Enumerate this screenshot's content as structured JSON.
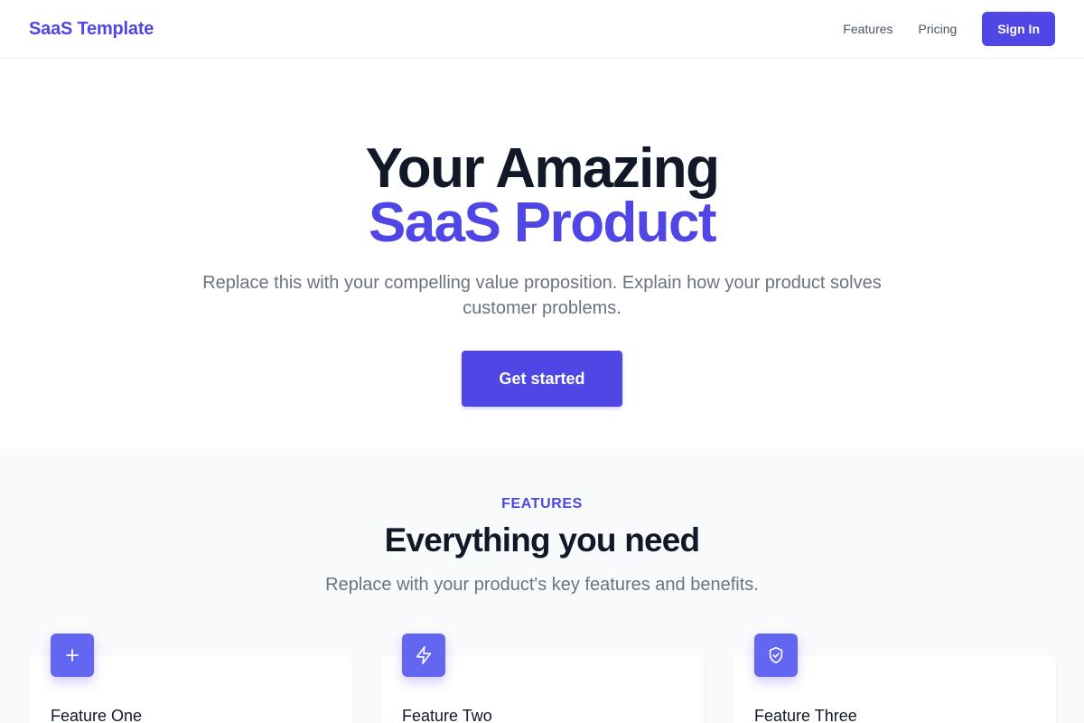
{
  "navbar": {
    "brand": "SaaS Template",
    "links": [
      "Features",
      "Pricing"
    ],
    "signin_label": "Sign In"
  },
  "hero": {
    "title_line_1": "Your Amazing",
    "title_line_2": "SaaS Product",
    "subtitle": "Replace this with your compelling value proposition. Explain how your product solves customer problems.",
    "cta_label": "Get started"
  },
  "features": {
    "eyebrow": "FEATURES",
    "title": "Everything you need",
    "subtitle": "Replace with your product's key features and benefits.",
    "cards": [
      {
        "name": "Feature One",
        "icon": "plus-icon"
      },
      {
        "name": "Feature Two",
        "icon": "lightning-bolt-icon"
      },
      {
        "name": "Feature Three",
        "icon": "shield-check-icon"
      }
    ]
  },
  "colors": {
    "brand": "#4f46e5",
    "icon_bg": "#6366f1",
    "heading": "#111827",
    "muted": "#6b7280",
    "section_bg": "#f9fafb"
  }
}
